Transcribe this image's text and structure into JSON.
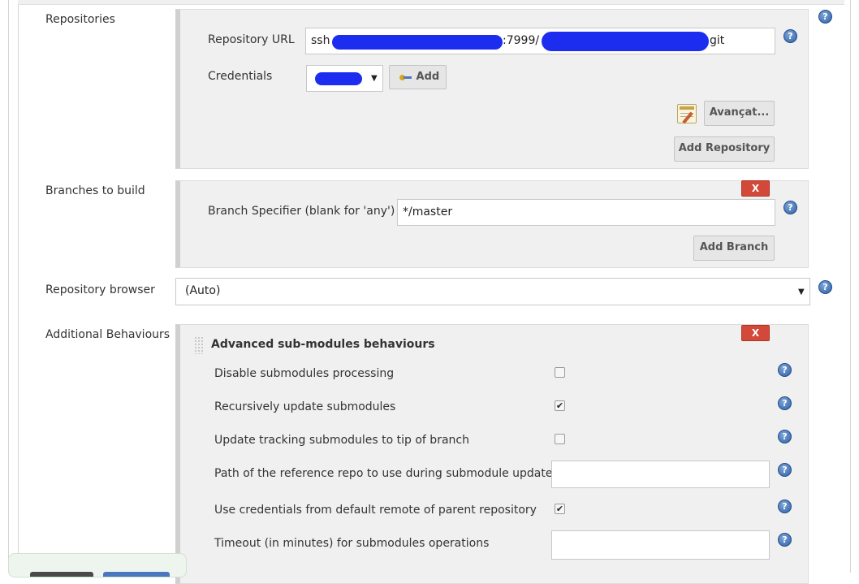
{
  "sections": {
    "repositories_label": "Repositories",
    "branches_label": "Branches to build",
    "repo_browser_label": "Repository browser",
    "additional_behaviours_label": "Additional Behaviours"
  },
  "repository": {
    "url_label": "Repository URL",
    "url_visible_start": "ssh",
    "url_visible_mid": ":7999/",
    "url_visible_end": "git",
    "credentials_label": "Credentials",
    "add_label": "Add",
    "advanced_label": "Avançat...",
    "add_repository_label": "Add Repository"
  },
  "branches": {
    "specifier_label": "Branch Specifier (blank for 'any')",
    "specifier_value": "*/master",
    "add_branch_label": "Add Branch",
    "delete_label": "X"
  },
  "repo_browser": {
    "selected": "(Auto)"
  },
  "behaviours": {
    "delete_label": "X",
    "title": "Advanced sub-modules behaviours",
    "options": [
      {
        "label": "Disable submodules processing",
        "checked": false
      },
      {
        "label": "Recursively update submodules",
        "checked": true
      },
      {
        "label": "Update tracking submodules to tip of branch",
        "checked": false
      },
      {
        "label": "Path of the reference repo to use during submodule update",
        "value": ""
      },
      {
        "label": "Use credentials from default remote of parent repository",
        "checked": true
      },
      {
        "label": "Timeout (in minutes) for submodules operations",
        "value": ""
      }
    ]
  },
  "icons": {
    "help": "help-icon",
    "key": "key-icon",
    "notepad": "notepad-icon",
    "check": "✔",
    "dropdown": "▼"
  },
  "colors": {
    "delete_button": "#d24939",
    "help_icon": "#2f5fa5",
    "redaction": "#1d2df0"
  }
}
